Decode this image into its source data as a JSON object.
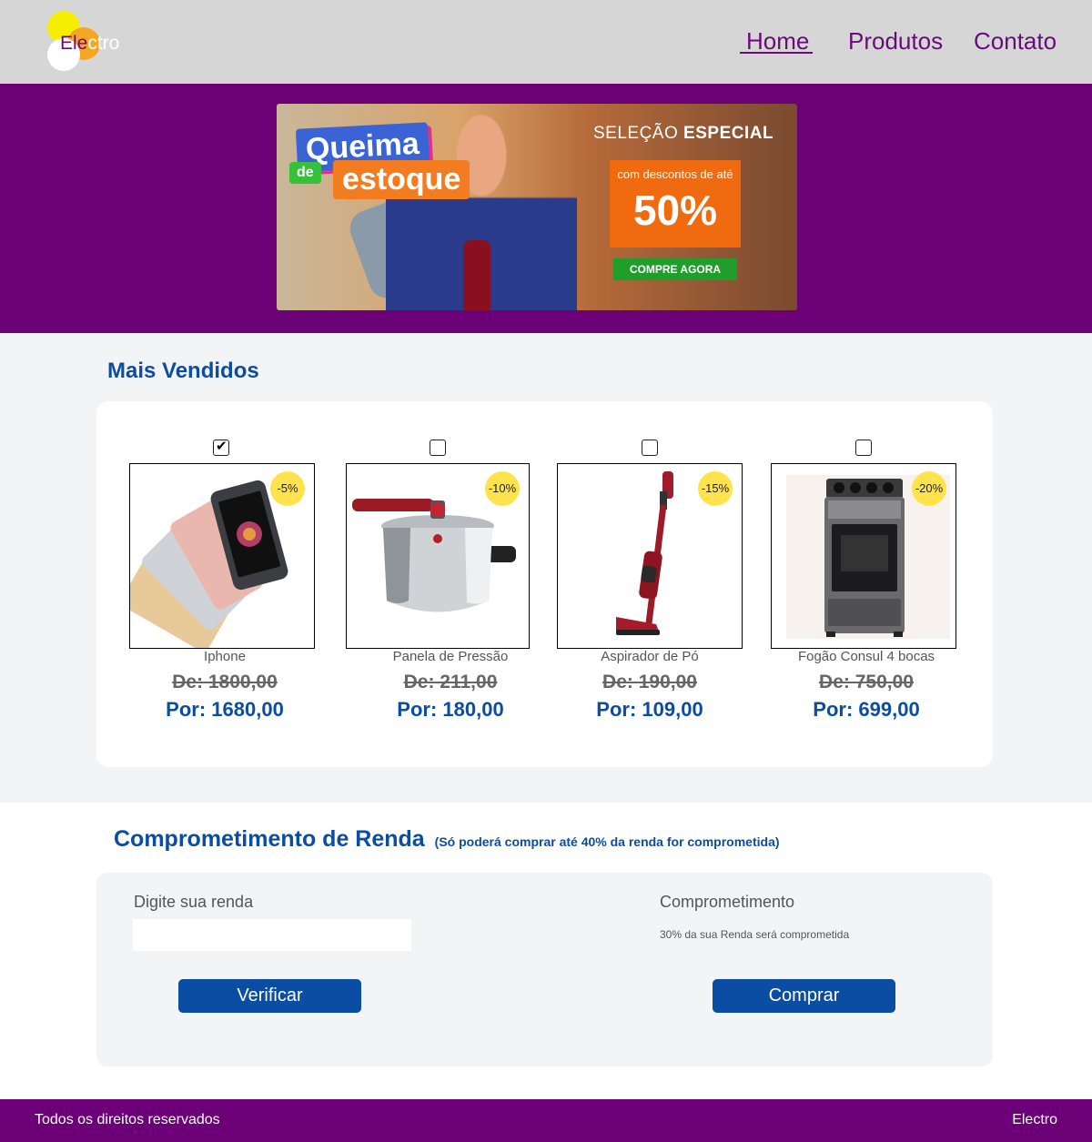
{
  "header": {
    "logo_text_a": "Ele",
    "logo_text_b": "c",
    "logo_text_c": "tro",
    "nav": [
      "Home",
      "Produtos",
      "Contato"
    ],
    "active_nav": "Home"
  },
  "banner": {
    "headline_1": "Queima",
    "headline_2": "de",
    "headline_3": "estoque",
    "selection_light": "SELEÇÃO",
    "selection_bold": "ESPECIAL",
    "discount_caption": "com descontos de até",
    "discount_value": "50%",
    "cta": "COMPRE AGORA"
  },
  "best_sellers": {
    "title": "Mais Vendidos",
    "products": [
      {
        "name": "Iphone",
        "discount": "-5%",
        "old_price": "De: 1800,00",
        "new_price": "Por: 1680,00",
        "checked": true,
        "icon": "smartphone-icon"
      },
      {
        "name": "Panela de Pressão",
        "discount": "-10%",
        "old_price": "De: 211,00",
        "new_price": "Por: 180,00",
        "checked": false,
        "icon": "pressure-cooker-icon"
      },
      {
        "name": "Aspirador de Pó",
        "discount": "-15%",
        "old_price": "De: 190,00",
        "new_price": "Por: 109,00",
        "checked": false,
        "icon": "vacuum-cleaner-icon"
      },
      {
        "name": "Fogão Consul 4 bocas",
        "discount": "-20%",
        "old_price": "De: 750,00",
        "new_price": "Por: 699,00",
        "checked": false,
        "icon": "stove-icon"
      }
    ]
  },
  "income": {
    "title": "Comprometimento de Renda",
    "subtitle": "(Só poderá comprar até 40% da renda for comprometida)",
    "input_label": "Digite sua renda",
    "input_value": "",
    "result_label": "Comprometimento",
    "result_text": "30% da sua Renda será comprometida",
    "verify_button": "Verificar",
    "buy_button": "Comprar"
  },
  "footer": {
    "rights": "Todos os direitos reservados",
    "brand": "Electro"
  }
}
